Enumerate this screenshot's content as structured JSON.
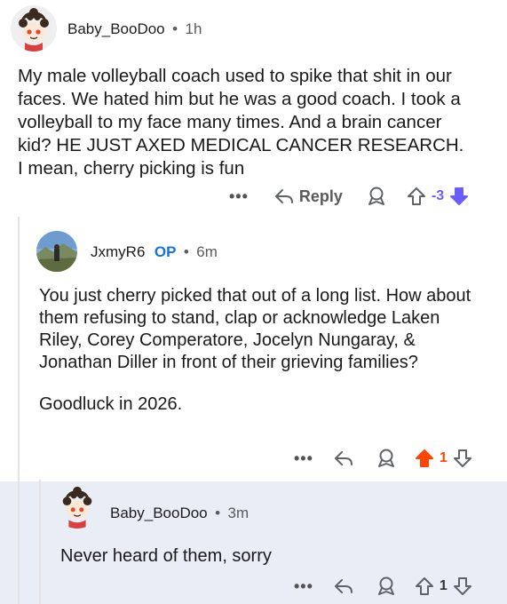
{
  "comments": [
    {
      "username": "Baby_BooDoo",
      "separator": "•",
      "time": "1h",
      "body": "My male volleyball coach used to spike that shit in our faces. We hated him but he was a good coach. I took a volleyball to my face many times. And a brain cancer kid? HE JUST AXED MEDICAL CANCER RESEARCH. I mean, cherry picking is fun",
      "actions": {
        "more": "•••",
        "reply": "Reply",
        "score": "-3"
      }
    },
    {
      "username": "JxmyR6",
      "op_badge": "OP",
      "separator": "•",
      "time": "6m",
      "body_paragraphs": [
        "You just cherry picked that out of a long list. How about them refusing to stand, clap or acknowledge Laken Riley, Corey Comperatore, Jocelyn Nungaray, & Jonathan Diller in front of their grieving families?",
        "Goodluck in 2026."
      ],
      "actions": {
        "more": "•••",
        "score": "1"
      }
    },
    {
      "username": "Baby_BooDoo",
      "separator": "•",
      "time": "3m",
      "body": "Never heard of them, sorry",
      "actions": {
        "more": "•••",
        "score": "1"
      }
    }
  ],
  "colors": {
    "upvote_active": "#ff4500",
    "downvote_active": "#6a5cff",
    "op_badge": "#1a73d9",
    "highlight_bg": "#e9edf6"
  },
  "icons": [
    "snoo-avatar",
    "profile-photo-avatar",
    "reply-arrow-icon",
    "award-icon",
    "upvote-icon",
    "downvote-icon"
  ]
}
